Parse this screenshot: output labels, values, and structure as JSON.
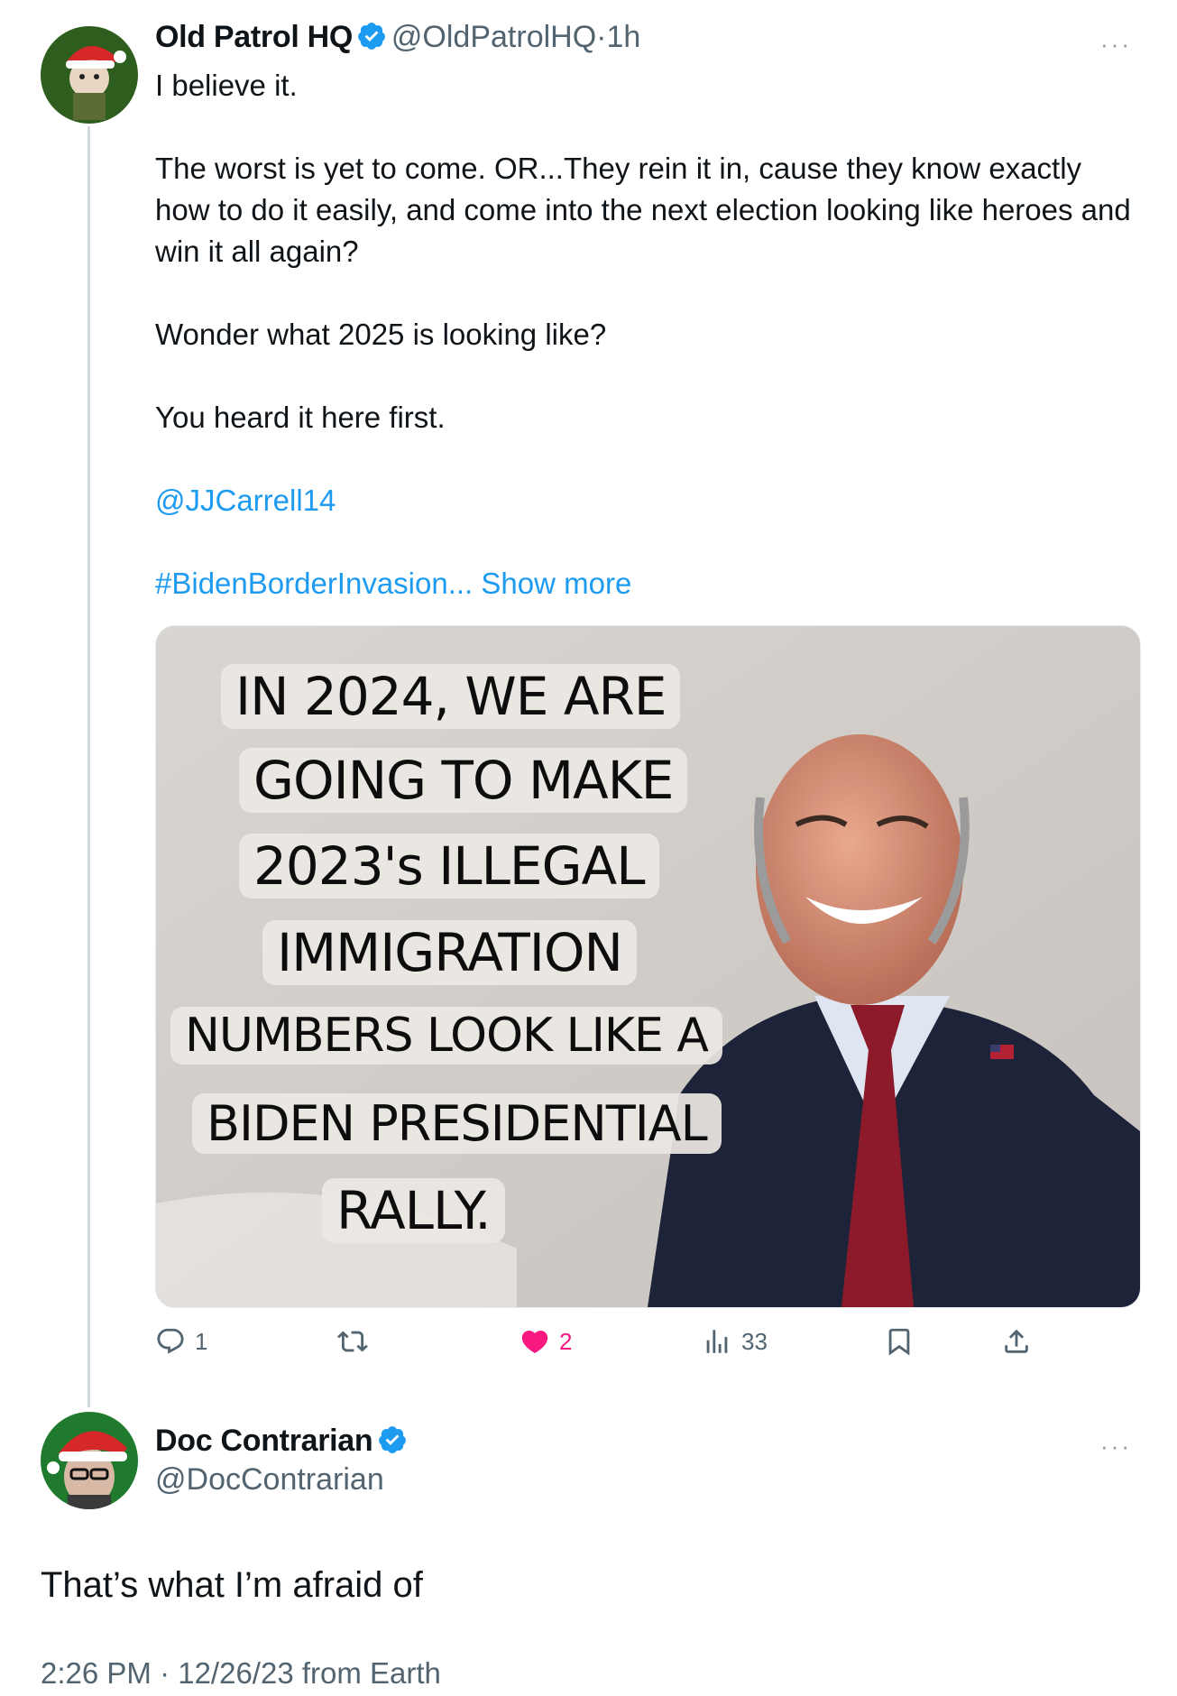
{
  "tweet1": {
    "display_name": "Old Patrol HQ",
    "handle": "@OldPatrolHQ",
    "separator": "·",
    "time": "1h",
    "more_label": "···",
    "paragraphs": [
      "I believe it.",
      "The worst is yet to come. OR...They rein it in, cause they know exactly how to do it easily, and come into the next election looking like heroes and win it all again?",
      "Wonder what 2025 is looking like?",
      "You heard it here first."
    ],
    "mention": "@JJCarrell14",
    "hashtag": "#BidenBorderInvasion...",
    "show_more": "Show more",
    "image_text_lines": [
      "IN 2024, WE ARE",
      "GOING TO MAKE",
      "2023's ILLEGAL",
      "IMMIGRATION",
      "NUMBERS LOOK LIKE A",
      "BIDEN PRESIDENTIAL",
      "RALLY."
    ],
    "actions": {
      "reply_count": "1",
      "repost_count": "",
      "like_count": "2",
      "views_count": "33"
    }
  },
  "tweet2": {
    "display_name": "Doc Contrarian",
    "handle": "@DocContrarian",
    "more_label": "···",
    "text": "That’s what I’m afraid of",
    "timestamp": "2:26 PM · 12/26/23 from Earth"
  },
  "colors": {
    "accent": "#1d9bf0",
    "like": "#f91880",
    "muted": "#536471"
  }
}
